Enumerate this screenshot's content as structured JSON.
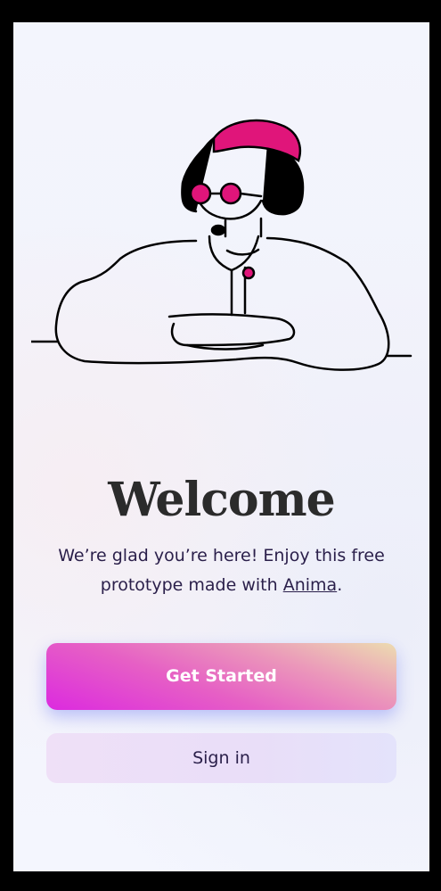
{
  "welcome": {
    "title": "Welcome",
    "subtitle_line1": "We’re glad you’re here! Enjoy this free",
    "subtitle_line2_pre": "prototype made with ",
    "subtitle_link": "Anima",
    "subtitle_line2_post": "."
  },
  "actions": {
    "get_started": "Get Started",
    "sign_in": "Sign in"
  },
  "colors": {
    "accent_start": "#dc2adf",
    "accent_end": "#ecdcb0",
    "hat_pink": "#e0157a",
    "text_dark": "#2a1f4a"
  },
  "icons": {
    "illustration": "welcome-person-illustration"
  }
}
